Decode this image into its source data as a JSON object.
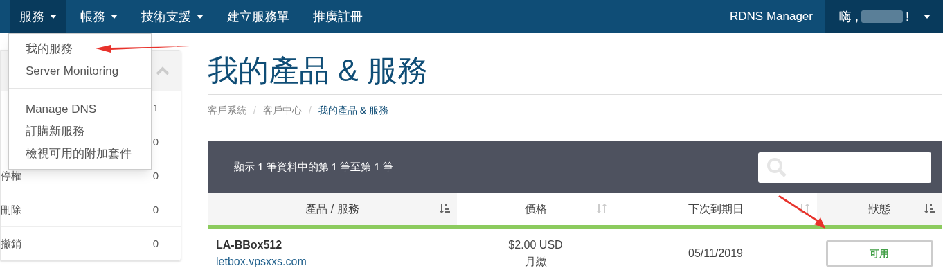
{
  "navbar": {
    "items": [
      {
        "label": "服務",
        "caret": true,
        "selected": true
      },
      {
        "label": "帳務",
        "caret": true,
        "selected": false
      },
      {
        "label": "技術支援",
        "caret": true,
        "selected": false
      },
      {
        "label": "建立服務單",
        "caret": false,
        "selected": false
      },
      {
        "label": "推廣註冊",
        "caret": false,
        "selected": false
      }
    ],
    "right_link": "RDNS Manager",
    "user_menu": {
      "greeting": "嗨 ,",
      "suffix": "!"
    }
  },
  "dropdown": {
    "groups": [
      [
        "我的服務",
        "Server Monitoring"
      ],
      [
        "Manage DNS",
        "訂購新服務",
        "檢視可用的附加套件"
      ]
    ]
  },
  "sidebar": {
    "items": [
      {
        "count": "1"
      },
      {
        "count": "0"
      },
      {
        "label": "停權",
        "count": "0"
      },
      {
        "label": "刪除",
        "count": "0"
      },
      {
        "label": "撤銷",
        "count": "0"
      }
    ]
  },
  "page_title": "我的產品 & 服務",
  "breadcrumb": [
    {
      "label": "客戶系統",
      "current": false
    },
    {
      "separator": "/",
      "label": "客戶中心",
      "current": false
    },
    {
      "separator": "/",
      "label": "我的產品 & 服務",
      "current": true
    }
  ],
  "table": {
    "info": "顯示 1 筆資料中的第 1 筆至第 1 筆",
    "columns": [
      {
        "label": "產品 / 服務",
        "sorted": true
      },
      {
        "label": "價格",
        "sorted": false
      },
      {
        "label": "下次到期日",
        "sorted": false
      },
      {
        "label": "狀態",
        "sorted": true
      }
    ],
    "rows": [
      {
        "product": "LA-BBox512",
        "domain": "letbox.vpsxxs.com",
        "price": "$2.00 USD",
        "cycle": "月繳",
        "due": "05/11/2019",
        "status": "可用"
      }
    ]
  }
}
